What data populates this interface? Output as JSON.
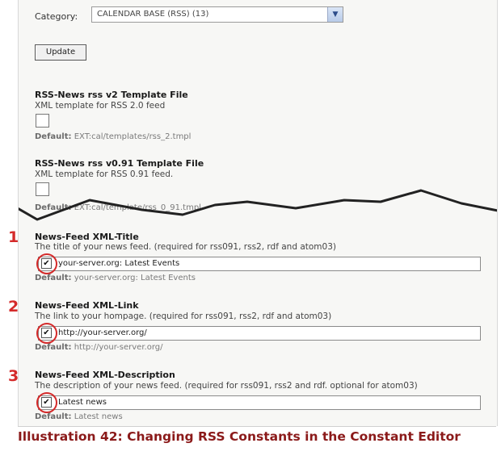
{
  "category": {
    "label": "Category:",
    "selected": "CALENDAR BASE (RSS) (13)"
  },
  "update_button": "Update",
  "template_v2": {
    "title": "RSS-News rss v2 Template File",
    "desc": "XML template for RSS 2.0 feed",
    "default_label": "Default:",
    "default_value": "EXT:cal/templates/rss_2.tmpl"
  },
  "template_v091": {
    "title": "RSS-News rss v0.91 Template File",
    "desc": "XML template for RSS 0.91 feed.",
    "default_label": "Default:",
    "default_value": "EXT:cal/template/rss_0_91.tmpl"
  },
  "feed_title": {
    "number": "1",
    "title": "News-Feed XML-Title",
    "desc": "The title of your news feed. (required for rss091, rss2, rdf and atom03)",
    "value": "your-server.org: Latest Events",
    "default_label": "Default:",
    "default_value": "your-server.org: Latest Events"
  },
  "feed_link": {
    "number": "2",
    "title": "News-Feed XML-Link",
    "desc": "The link to your hompage. (required for rss091, rss2, rdf and atom03)",
    "value": "http://your-server.org/",
    "default_label": "Default:",
    "default_value": "http://your-server.org/"
  },
  "feed_desc": {
    "number": "3",
    "title": "News-Feed XML-Description",
    "desc": "The description of your news feed. (required for rss091, rss2 and rdf. optional for atom03)",
    "value": "Latest news",
    "default_label": "Default:",
    "default_value": "Latest news"
  },
  "caption": "Illustration 42: Changing RSS Constants in the Constant Editor"
}
